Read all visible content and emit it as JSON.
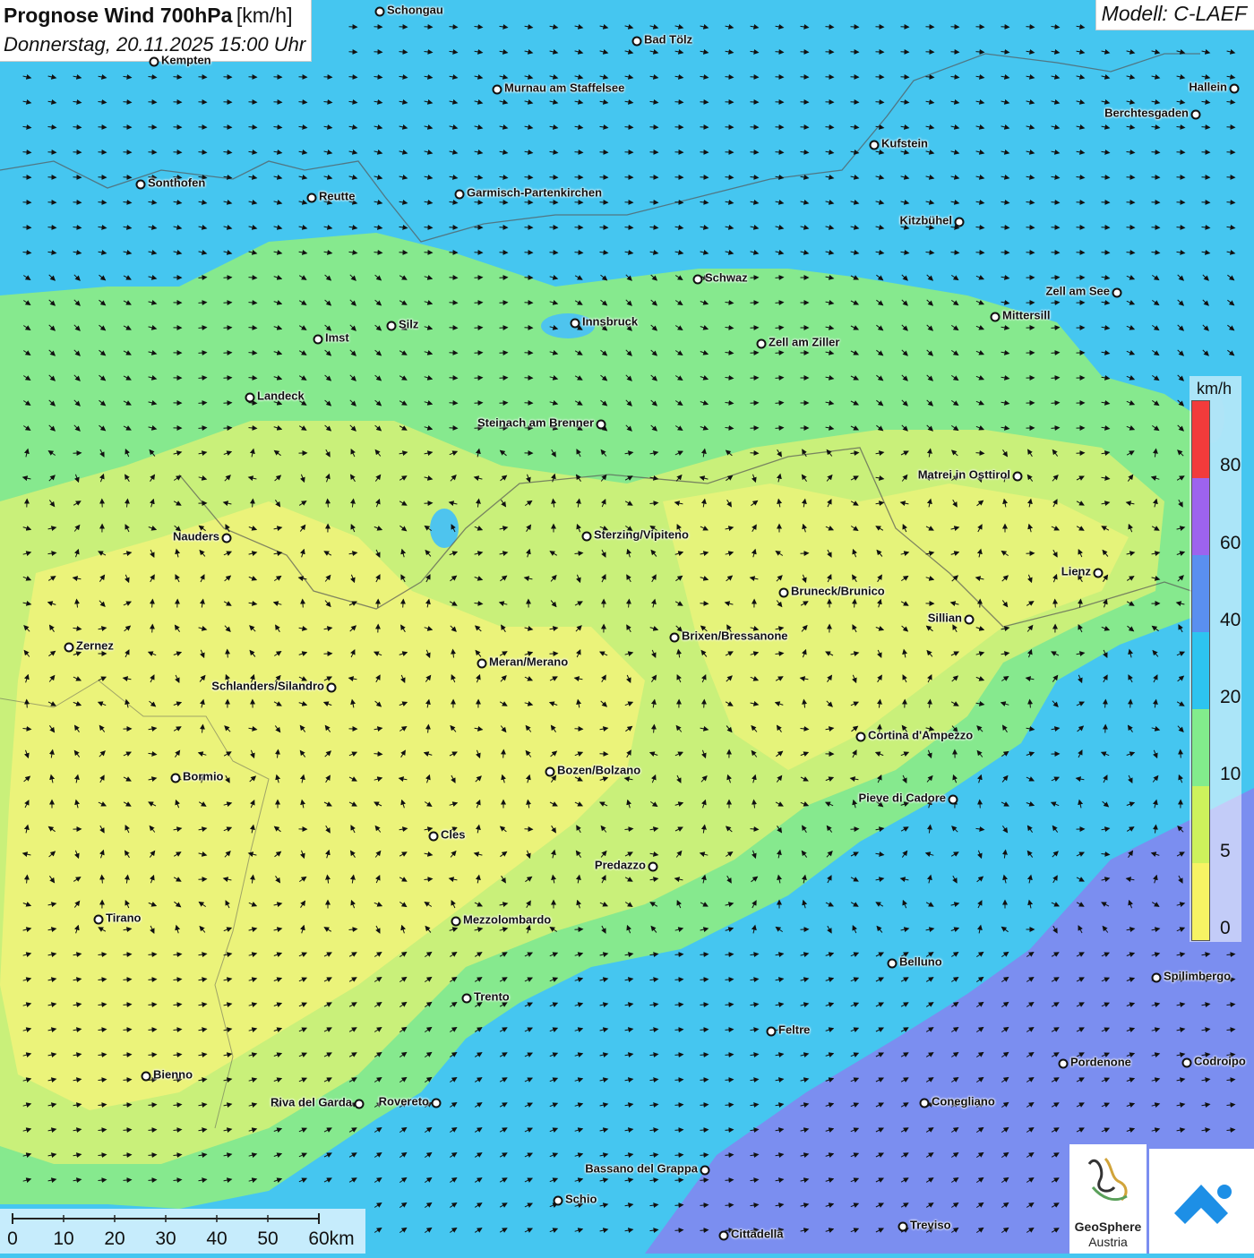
{
  "title": {
    "main": "Prognose Wind 700hPa",
    "unit": "[km/h]",
    "date": "Donnerstag, 20.11.2025 15:00 Uhr"
  },
  "model": "Modell: C-LAEF",
  "colors": {
    "lake": "#4ec4ee",
    "band_blue": "#45c6f0",
    "band_green": "#86e98e",
    "band_lightgreen": "#b9ef80",
    "band_yellow": "#f1f37a",
    "band_violet": "#7b8ef0"
  },
  "legend": {
    "unit": "km/h",
    "ticks": [
      "80",
      "60",
      "40",
      "20",
      "10",
      "5",
      "0"
    ],
    "colors": [
      "#f23b3b",
      "#9d63ee",
      "#5a8ff0",
      "#2dc4f0",
      "#82ec8c",
      "#cdf25c",
      "#f7f364"
    ]
  },
  "cities": [
    {
      "name": "Schongau"
    },
    {
      "name": "Bad Tölz"
    },
    {
      "name": "Kempten"
    },
    {
      "name": "Murnau am Staffelsee"
    },
    {
      "name": "Hallein"
    },
    {
      "name": "Berchtesgaden"
    },
    {
      "name": "Kufstein"
    },
    {
      "name": "Sonthofen"
    },
    {
      "name": "Reutte"
    },
    {
      "name": "Garmisch-Partenkirchen"
    },
    {
      "name": "Kitzbühel"
    },
    {
      "name": "Schwaz"
    },
    {
      "name": "Zell am See"
    },
    {
      "name": "Mittersill"
    },
    {
      "name": "Innsbruck"
    },
    {
      "name": "Silz"
    },
    {
      "name": "Imst"
    },
    {
      "name": "Zell am Ziller"
    },
    {
      "name": "Landeck"
    },
    {
      "name": "Steinach am Brenner"
    },
    {
      "name": "Matrei in Osttirol"
    },
    {
      "name": "Nauders"
    },
    {
      "name": "Sterzing/Vipiteno"
    },
    {
      "name": "Lienz"
    },
    {
      "name": "Bruneck/Brunico"
    },
    {
      "name": "Sillian"
    },
    {
      "name": "Brixen/Bressanone"
    },
    {
      "name": "Zernez"
    },
    {
      "name": "Meran/Merano"
    },
    {
      "name": "Schlanders/Silandro"
    },
    {
      "name": "Cortina d'Ampezzo"
    },
    {
      "name": "Bozen/Bolzano"
    },
    {
      "name": "Bormio"
    },
    {
      "name": "Pieve di Cadore"
    },
    {
      "name": "Cles"
    },
    {
      "name": "Predazzo"
    },
    {
      "name": "Tirano"
    },
    {
      "name": "Mezzolombardo"
    },
    {
      "name": "Belluno"
    },
    {
      "name": "Spilimbergo"
    },
    {
      "name": "Trento"
    },
    {
      "name": "Feltre"
    },
    {
      "name": "Pordenone"
    },
    {
      "name": "Codroipo"
    },
    {
      "name": "Bienno"
    },
    {
      "name": "Riva del Garda"
    },
    {
      "name": "Rovereto"
    },
    {
      "name": "Conegliano"
    },
    {
      "name": "Bassano del Grappa"
    },
    {
      "name": "Schio"
    },
    {
      "name": "Treviso"
    },
    {
      "name": "Cittadella"
    }
  ],
  "scale": {
    "labels": [
      "0",
      "10",
      "20",
      "30",
      "40",
      "50",
      "60km"
    ]
  },
  "logo": {
    "name": "GeoSphere",
    "sub": "Austria"
  }
}
